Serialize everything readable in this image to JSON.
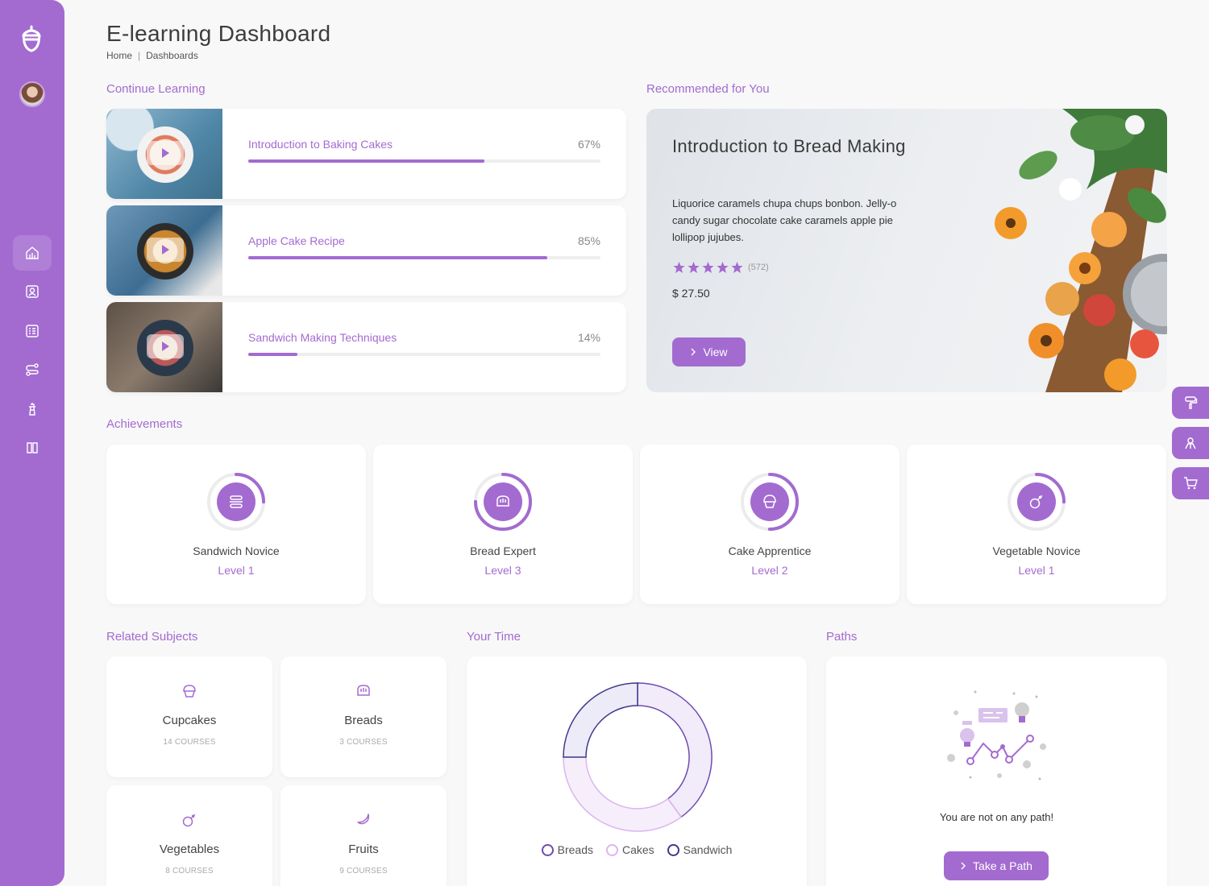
{
  "header": {
    "title": "E-learning Dashboard",
    "breadcrumb": [
      {
        "label": "Home"
      },
      {
        "label": "Dashboards"
      }
    ],
    "breadcrumb_sep": "|"
  },
  "sections": {
    "continue_learning": "Continue Learning",
    "recommended": "Recommended for You",
    "achievements": "Achievements",
    "related_subjects": "Related Subjects",
    "your_time": "Your Time",
    "paths": "Paths"
  },
  "courses": [
    {
      "name": "Introduction to Baking Cakes",
      "percent_label": "67%",
      "progress": 0.67
    },
    {
      "name": "Apple Cake Recipe",
      "percent_label": "85%",
      "progress": 0.85
    },
    {
      "name": "Sandwich Making Techniques",
      "percent_label": "14%",
      "progress": 0.14
    }
  ],
  "recommended": {
    "title": "Introduction to Bread Making",
    "description": "Liquorice caramels chupa chups bonbon. Jelly-o candy sugar chocolate cake caramels apple pie lollipop jujubes.",
    "rating": 5,
    "rating_count": "(572)",
    "price": "$ 27.50",
    "button": "View"
  },
  "achievements": [
    {
      "name": "Sandwich Novice",
      "level": "Level 1",
      "icon": "sandwich-icon",
      "fraction": 0.25
    },
    {
      "name": "Bread Expert",
      "level": "Level 3",
      "icon": "bread-icon",
      "fraction": 0.75
    },
    {
      "name": "Cake Apprentice",
      "level": "Level 2",
      "icon": "cupcake-icon",
      "fraction": 0.5
    },
    {
      "name": "Vegetable Novice",
      "level": "Level 1",
      "icon": "vegetable-icon",
      "fraction": 0.25
    }
  ],
  "subjects": [
    {
      "name": "Cupcakes",
      "count": "14 COURSES",
      "icon": "cupcake-icon"
    },
    {
      "name": "Breads",
      "count": "3 COURSES",
      "icon": "bread-icon"
    },
    {
      "name": "Vegetables",
      "count": "8 COURSES",
      "icon": "vegetable-icon"
    },
    {
      "name": "Fruits",
      "count": "9 COURSES",
      "icon": "banana-icon"
    }
  ],
  "your_time": {
    "legend": [
      {
        "label": "Breads",
        "color": "#6f4bb0"
      },
      {
        "label": "Cakes",
        "color": "#dbb5ef"
      },
      {
        "label": "Sandwich",
        "color": "#3d3a8a"
      }
    ]
  },
  "chart_data": {
    "type": "pie",
    "categories": [
      "Breads",
      "Cakes",
      "Sandwich"
    ],
    "values": [
      40,
      35,
      25
    ],
    "legend_position": "bottom"
  },
  "paths": {
    "empty_text": "You are not on any path!",
    "button": "Take a Path"
  },
  "sidebar": {
    "items": [
      "dashboard-icon",
      "portrait-icon",
      "checklist-icon",
      "route-icon",
      "tower-icon",
      "book-icon"
    ]
  },
  "floating_tabs": [
    "paint-roller-icon",
    "user-gender-icon",
    "cart-icon"
  ],
  "colors": {
    "accent": "#a36bd0",
    "background": "#f8f8f8"
  }
}
